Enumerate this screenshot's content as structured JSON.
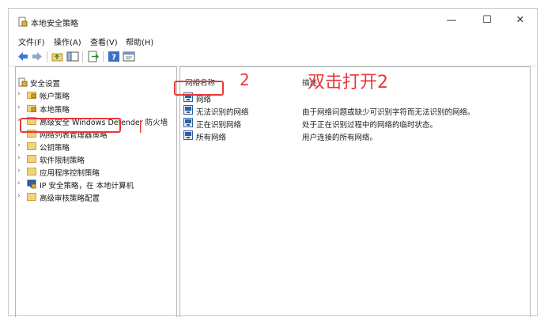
{
  "window": {
    "title": "本地安全策略"
  },
  "title_controls": {
    "minimize": "—",
    "maximize": "☐",
    "close": "✕"
  },
  "menu": [
    "文件(F)",
    "操作(A)",
    "查看(V)",
    "帮助(H)"
  ],
  "toolbar_icons": [
    "back-icon",
    "forward-icon",
    "up-folder-icon",
    "show-hide-tree-icon",
    "export-icon",
    "help-icon",
    "properties-icon"
  ],
  "tree": {
    "root": "安全设置",
    "items": [
      {
        "label": "帐户策略",
        "expandable": true
      },
      {
        "label": "本地策略",
        "expandable": true
      },
      {
        "label": "高级安全 Windows Defender 防火墙",
        "expandable": true
      },
      {
        "label": "网络列表管理器策略",
        "expandable": false,
        "selected": true
      },
      {
        "label": "公钥策略",
        "expandable": true
      },
      {
        "label": "软件限制策略",
        "expandable": true
      },
      {
        "label": "应用程序控制策略",
        "expandable": true
      },
      {
        "label": "IP 安全策略，在 本地计算机",
        "expandable": true
      },
      {
        "label": "高级审核策略配置",
        "expandable": true
      }
    ]
  },
  "columns": {
    "name": "网络名称",
    "description": "描述"
  },
  "rows": [
    {
      "name": "网络",
      "description": ""
    },
    {
      "name": "无法识别的网络",
      "description": "由于网络问题或缺少可识别字符而无法识别的网络。"
    },
    {
      "name": "正在识别网络",
      "description": "处于正在识别过程中的网络的临时状态。"
    },
    {
      "name": "所有网络",
      "description": "用户连接的所有网络。"
    }
  ],
  "annotations": {
    "mark1": "|",
    "mark2": "2",
    "instruction": "双击打开2"
  },
  "colors": {
    "annotation": "#e8383a",
    "folder": "#f2d27a"
  }
}
